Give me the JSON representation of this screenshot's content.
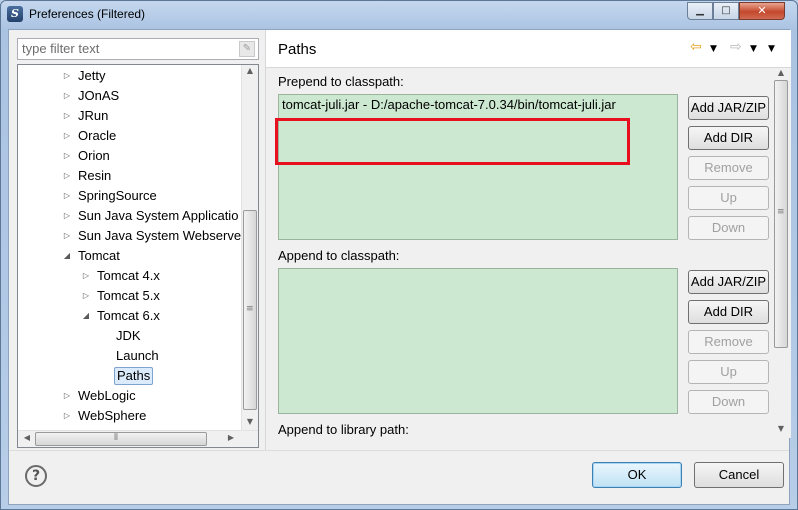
{
  "window": {
    "title": "Preferences (Filtered)",
    "app_icon_letter": "S",
    "minimize_glyph": "▁",
    "maximize_glyph": "□",
    "close_glyph": "✕"
  },
  "filter": {
    "placeholder": "type filter text"
  },
  "tree": {
    "items": [
      {
        "label": "Jetty",
        "arrow": "▷"
      },
      {
        "label": "JOnAS",
        "arrow": "▷"
      },
      {
        "label": "JRun",
        "arrow": "▷"
      },
      {
        "label": "Oracle",
        "arrow": "▷"
      },
      {
        "label": "Orion",
        "arrow": "▷"
      },
      {
        "label": "Resin",
        "arrow": "▷"
      },
      {
        "label": "SpringSource",
        "arrow": "▷"
      },
      {
        "label": "Sun Java System Applicatio",
        "arrow": "▷"
      },
      {
        "label": "Sun Java System Webserve",
        "arrow": "▷"
      },
      {
        "label": "Tomcat",
        "arrow": "◢"
      },
      {
        "label": "Tomcat  4.x",
        "arrow": "▷"
      },
      {
        "label": "Tomcat  5.x",
        "arrow": "▷"
      },
      {
        "label": "Tomcat  6.x",
        "arrow": "◢"
      },
      {
        "label": "JDK",
        "arrow": ""
      },
      {
        "label": "Launch",
        "arrow": ""
      },
      {
        "label": "Paths",
        "arrow": ""
      },
      {
        "label": "WebLogic",
        "arrow": "▷"
      },
      {
        "label": "WebSphere",
        "arrow": "▷"
      }
    ]
  },
  "page": {
    "title": "Paths",
    "prepend_label": "Prepend to classpath:",
    "prepend_entry": "tomcat-juli.jar - D:/apache-tomcat-7.0.34/bin/tomcat-juli.jar",
    "append_label": "Append to classpath:",
    "library_label": "Append to library path:"
  },
  "buttons": {
    "add_jar": "Add JAR/ZIP",
    "add_dir": "Add DIR",
    "remove": "Remove",
    "up": "Up",
    "down": "Down"
  },
  "dialog": {
    "help_glyph": "?",
    "ok": "OK",
    "cancel": "Cancel"
  },
  "colors": {
    "list_background": "#cde8d0",
    "highlight_box": "#e8101e"
  }
}
